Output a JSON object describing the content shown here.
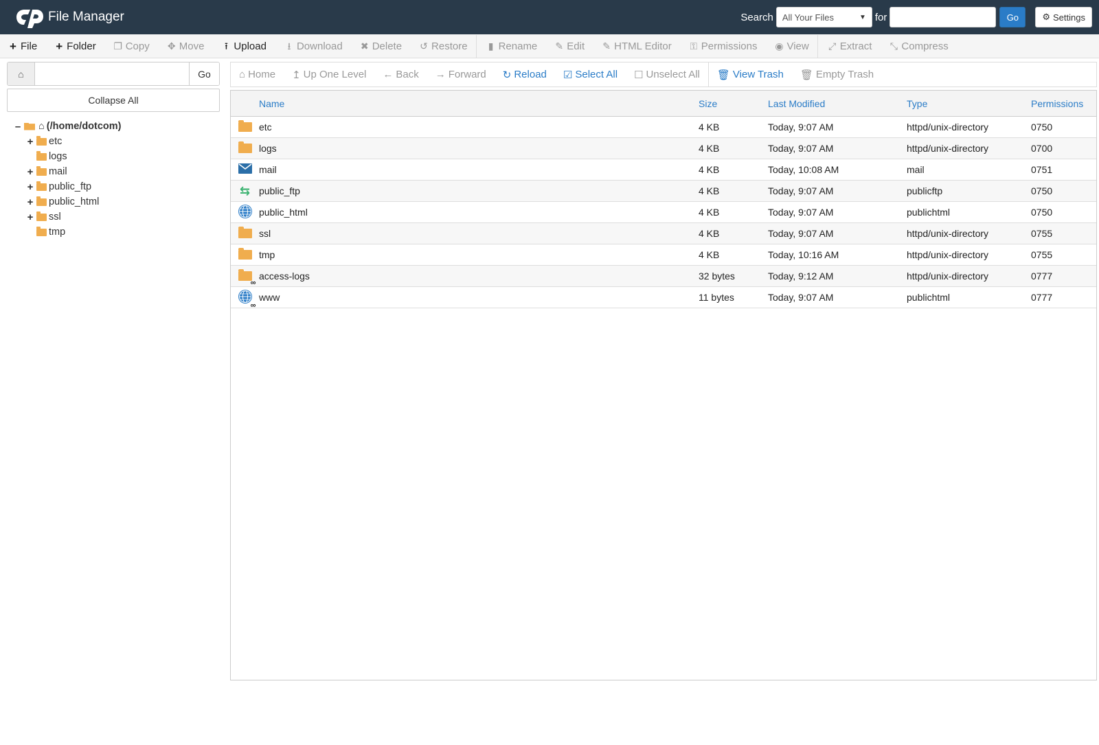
{
  "header": {
    "app_title": "File Manager",
    "search_label": "Search",
    "search_scope": "All Your Files",
    "for_label": "for",
    "search_value": "",
    "go_label": "Go",
    "settings_label": "Settings"
  },
  "toolbar": {
    "file": "File",
    "folder": "Folder",
    "copy": "Copy",
    "move": "Move",
    "upload": "Upload",
    "download": "Download",
    "delete": "Delete",
    "restore": "Restore",
    "rename": "Rename",
    "edit": "Edit",
    "html_editor": "HTML Editor",
    "permissions": "Permissions",
    "view": "View",
    "extract": "Extract",
    "compress": "Compress"
  },
  "left": {
    "path_value": "",
    "go_label": "Go",
    "collapse_all": "Collapse All",
    "root_label": "(/home/dotcom)",
    "tree": [
      {
        "label": "etc",
        "expandable": true
      },
      {
        "label": "logs",
        "expandable": false
      },
      {
        "label": "mail",
        "expandable": true
      },
      {
        "label": "public_ftp",
        "expandable": true
      },
      {
        "label": "public_html",
        "expandable": true
      },
      {
        "label": "ssl",
        "expandable": true
      },
      {
        "label": "tmp",
        "expandable": false
      }
    ]
  },
  "nav": {
    "home": "Home",
    "up_one_level": "Up One Level",
    "back": "Back",
    "forward": "Forward",
    "reload": "Reload",
    "select_all": "Select All",
    "unselect_all": "Unselect All",
    "view_trash": "View Trash",
    "empty_trash": "Empty Trash"
  },
  "table": {
    "columns": [
      "Name",
      "Size",
      "Last Modified",
      "Type",
      "Permissions"
    ],
    "rows": [
      {
        "icon": "folder-icon",
        "name": "etc",
        "size": "4 KB",
        "modified": "Today, 9:07 AM",
        "type": "httpd/unix-directory",
        "perms": "0750"
      },
      {
        "icon": "folder-icon",
        "name": "logs",
        "size": "4 KB",
        "modified": "Today, 9:07 AM",
        "type": "httpd/unix-directory",
        "perms": "0700"
      },
      {
        "icon": "envelope-icon",
        "name": "mail",
        "size": "4 KB",
        "modified": "Today, 10:08 AM",
        "type": "mail",
        "perms": "0751"
      },
      {
        "icon": "exchange-icon",
        "name": "public_ftp",
        "size": "4 KB",
        "modified": "Today, 9:07 AM",
        "type": "publicftp",
        "perms": "0750"
      },
      {
        "icon": "globe-icon",
        "name": "public_html",
        "size": "4 KB",
        "modified": "Today, 9:07 AM",
        "type": "publichtml",
        "perms": "0750"
      },
      {
        "icon": "folder-icon",
        "name": "ssl",
        "size": "4 KB",
        "modified": "Today, 9:07 AM",
        "type": "httpd/unix-directory",
        "perms": "0755"
      },
      {
        "icon": "folder-icon",
        "name": "tmp",
        "size": "4 KB",
        "modified": "Today, 10:16 AM",
        "type": "httpd/unix-directory",
        "perms": "0755"
      },
      {
        "icon": "folder-link-icon",
        "name": "access-logs",
        "size": "32 bytes",
        "modified": "Today, 9:12 AM",
        "type": "httpd/unix-directory",
        "perms": "0777"
      },
      {
        "icon": "globe-link-icon",
        "name": "www",
        "size": "11 bytes",
        "modified": "Today, 9:07 AM",
        "type": "publichtml",
        "perms": "0777"
      }
    ]
  },
  "colors": {
    "header_bg": "#293a4a",
    "accent": "#2a7cc7",
    "folder": "#f0ad4e"
  }
}
